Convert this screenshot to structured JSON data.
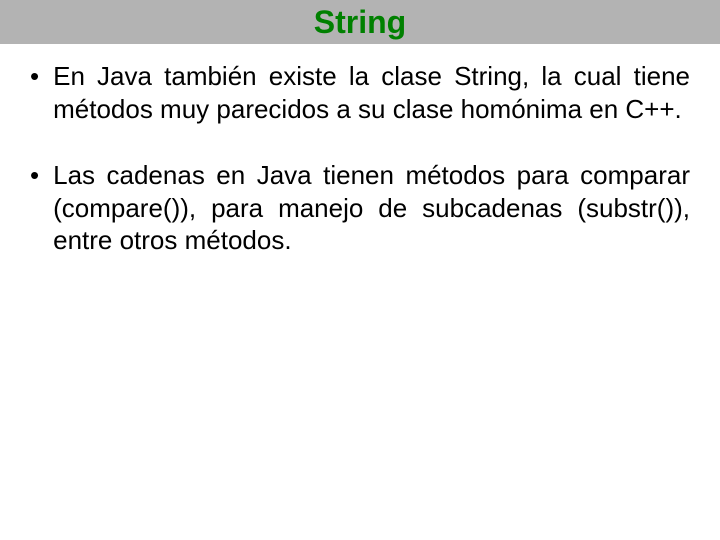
{
  "slide": {
    "title": "String",
    "bullets": [
      "En Java también existe la clase String, la cual tiene métodos muy parecidos a su clase homónima en C++.",
      "Las cadenas en Java tienen métodos para comparar (compare()), para manejo de subcadenas (substr()), entre otros métodos."
    ],
    "marker": "•"
  },
  "colors": {
    "title_bg": "#b3b3b3",
    "title_fg": "#008000",
    "body_fg": "#000000"
  }
}
